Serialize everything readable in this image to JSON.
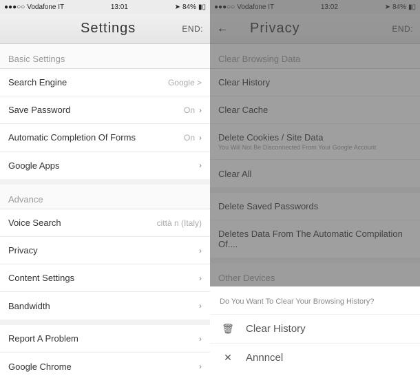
{
  "left": {
    "status": {
      "carrier": "Vodafone IT",
      "signal": "●●●○○",
      "time": "13:01",
      "battery": "84%",
      "nav": "➤"
    },
    "header": {
      "title": "Settings",
      "right": "END:"
    },
    "basic_label": "Basic Settings",
    "rows": {
      "search_engine": {
        "label": "Search Engine",
        "value": "Google >"
      },
      "save_password": {
        "label": "Save Password",
        "value": "On"
      },
      "auto_forms": {
        "label": "Automatic Completion Of Forms",
        "value": "On"
      },
      "google_apps": {
        "label": "Google Apps"
      }
    },
    "advance_label": "Advance",
    "adv": {
      "voice_search": {
        "label": "Voice Search",
        "value": "città n (Italy)"
      },
      "privacy": {
        "label": "Privacy"
      },
      "content_settings": {
        "label": "Content Settings"
      },
      "bandwidth": {
        "label": "Bandwidth"
      }
    },
    "bottom": {
      "report": {
        "label": "Report A Problem"
      },
      "chrome": {
        "label": "Google Chrome"
      }
    }
  },
  "right": {
    "status": {
      "carrier": "Vodafone IT",
      "signal": "●●●○○",
      "time": "13:02",
      "battery": "84%",
      "nav": "➤"
    },
    "header": {
      "title": "Privacy",
      "right": "END:"
    },
    "section_clear": "Clear Browsing Data",
    "rows": {
      "clear_history": "Clear History",
      "clear_cache": "Clear Cache",
      "cookies": {
        "label": "Delete Cookies / Site Data",
        "sub": "You Will Not Be Disconnected From Your Google Account"
      },
      "clear_all": "Clear All",
      "saved_pw": "Delete Saved Passwords",
      "auto_comp": "Deletes Data From The Automatic Compilation Of...."
    },
    "section_other": "Other Devices",
    "sheet": {
      "prompt": "Do You Want To Clear Your Browsing History?",
      "clear": "Clear History",
      "cancel": "Annncel"
    }
  }
}
